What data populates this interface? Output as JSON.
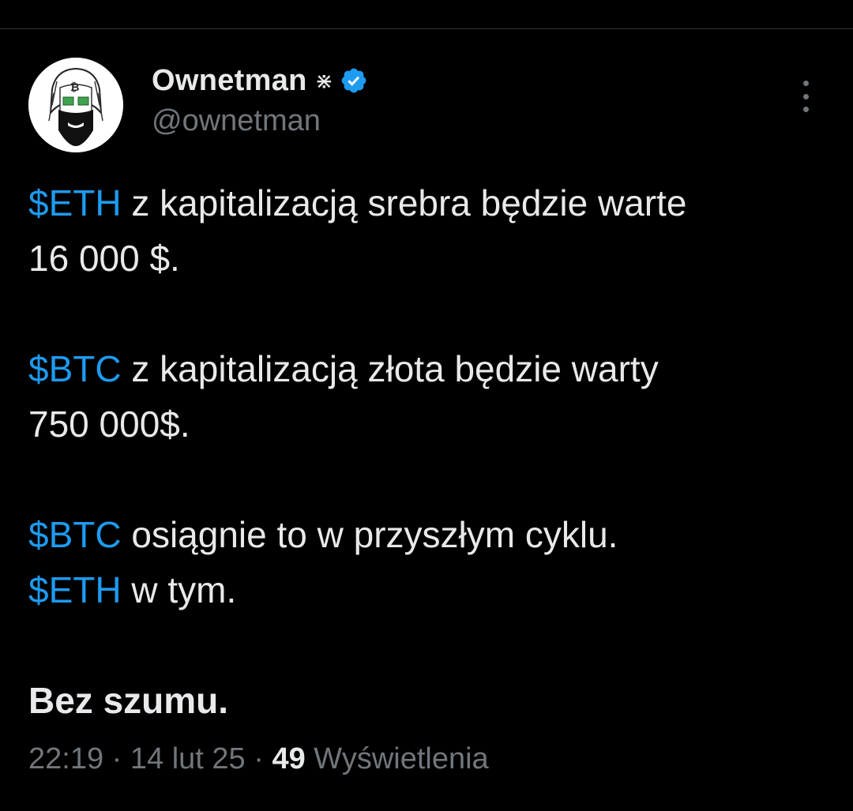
{
  "author": {
    "display_name": "Ownetman",
    "name_glyph": "⋇",
    "handle": "@ownetman",
    "verified": true,
    "avatar_icon": "bearded-bitcoin-man-avatar"
  },
  "tweet": {
    "lines": [
      {
        "cashtag": "$ETH",
        "text": " z kapitalizacją srebra będzie warte"
      },
      {
        "text": "16 000 $."
      },
      {
        "cashtag": "$BTC",
        "text": " z kapitalizacją złota będzie warty"
      },
      {
        "text": "750 000$."
      },
      {
        "cashtag": "$BTC",
        "text": " osiągnie to w przyszłym cyklu."
      },
      {
        "cashtag": "$ETH",
        "text": " w tym."
      },
      {
        "text": "Bez szumu."
      }
    ]
  },
  "meta": {
    "time": "22:19",
    "separator": " · ",
    "date": "14 lut 25",
    "views_count": "49",
    "views_label": " Wyświetlenia"
  },
  "colors": {
    "background": "#000000",
    "text": "#e7e9ea",
    "muted": "#71767b",
    "accent": "#1d9bf0"
  },
  "icons": {
    "verified": "verified-badge-icon",
    "more": "more-options-icon"
  }
}
